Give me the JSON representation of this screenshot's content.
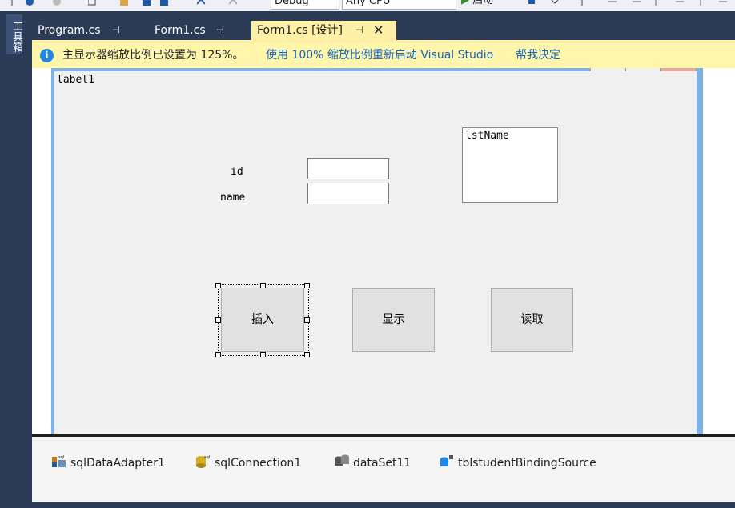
{
  "toolbar": {
    "config_value": "Debug",
    "platform_value": "Any CPU",
    "start_label": "启动"
  },
  "toolbox": {
    "label": "工具箱"
  },
  "tabs": [
    {
      "label": "Program.cs",
      "pin": "ꟷ"
    },
    {
      "label": "Form1.cs",
      "pin": "ꟷ"
    },
    {
      "label": "Form1.cs [设计]",
      "pin": "ꟷ",
      "close": "✕"
    }
  ],
  "infobar": {
    "icon": "i",
    "message": "主显示器缩放比例已设置为 125%。",
    "link_restart": "使用 100% 缩放比例重新启动 Visual Studio",
    "link_help": "帮我决定"
  },
  "form": {
    "label1": "label1",
    "id_label": "id",
    "name_label": "name",
    "id_value": "",
    "name_value": "",
    "listbox_name": "lstName",
    "insert_button": "插入",
    "show_button": "显示",
    "read_button": "读取"
  },
  "tray": {
    "components": [
      {
        "name": "sqlDataAdapter1",
        "icon": "sql-data-adapter-icon"
      },
      {
        "name": "sqlConnection1",
        "icon": "sql-connection-icon"
      },
      {
        "name": "dataSet11",
        "icon": "dataset-icon"
      },
      {
        "name": "tblstudentBindingSource",
        "icon": "binding-source-icon"
      }
    ]
  },
  "colors": {
    "chrome": "#2b3a55",
    "active_tab": "#fff0a8",
    "infobar": "#fff5ab",
    "link": "#1565c0",
    "form_border": "#7fb2e5",
    "form_bg": "#f0f0f0"
  }
}
